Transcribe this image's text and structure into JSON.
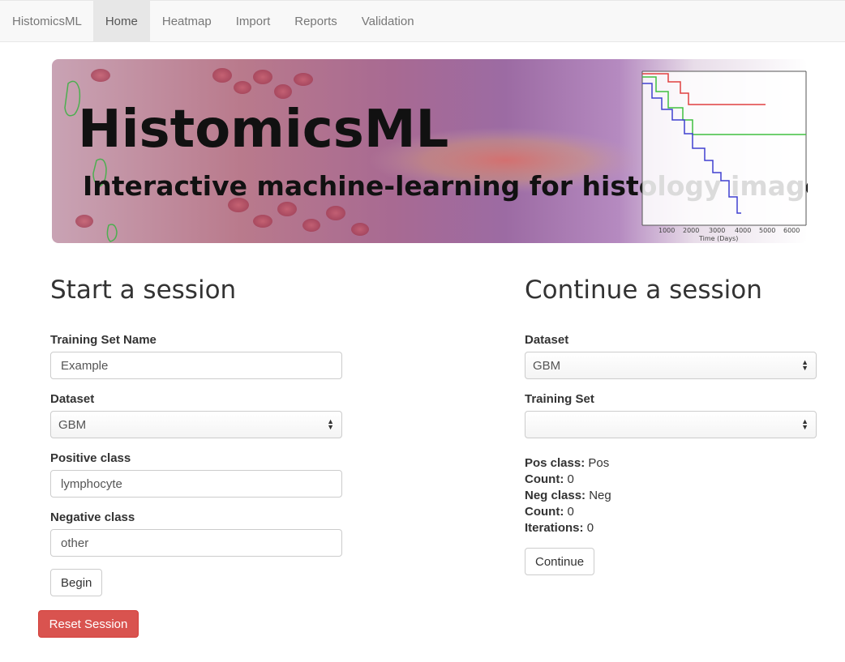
{
  "navbar": {
    "brand": "HistomicsML",
    "items": [
      {
        "label": "Home",
        "active": true
      },
      {
        "label": "Heatmap",
        "active": false
      },
      {
        "label": "Import",
        "active": false
      },
      {
        "label": "Reports",
        "active": false
      },
      {
        "label": "Validation",
        "active": false
      }
    ]
  },
  "banner": {
    "title": "HistomicsML",
    "subtitle": "Interactive machine-learning for histology images",
    "plot_xticks": [
      "1000",
      "2000",
      "3000",
      "4000",
      "5000",
      "6000"
    ],
    "plot_xlabel": "Time (Days)"
  },
  "start_session": {
    "heading": "Start a session",
    "training_set_label": "Training Set Name",
    "training_set_value": "Example",
    "dataset_label": "Dataset",
    "dataset_value": "GBM",
    "positive_label": "Positive class",
    "positive_value": "lymphocyte",
    "negative_label": "Negative class",
    "negative_value": "other",
    "begin_button": "Begin",
    "reset_button": "Reset Session"
  },
  "continue_session": {
    "heading": "Continue a session",
    "dataset_label": "Dataset",
    "dataset_value": "GBM",
    "training_set_label": "Training Set",
    "training_set_value": "",
    "pos_class_label": "Pos class:",
    "pos_class_value": "Pos",
    "pos_count_label": "Count:",
    "pos_count_value": "0",
    "neg_class_label": "Neg class:",
    "neg_class_value": "Neg",
    "neg_count_label": "Count:",
    "neg_count_value": "0",
    "iterations_label": "Iterations:",
    "iterations_value": "0",
    "continue_button": "Continue"
  },
  "colors": {
    "navbar_bg": "#f8f8f8",
    "active_tab_bg": "#e7e7e7",
    "danger": "#d9534f"
  }
}
